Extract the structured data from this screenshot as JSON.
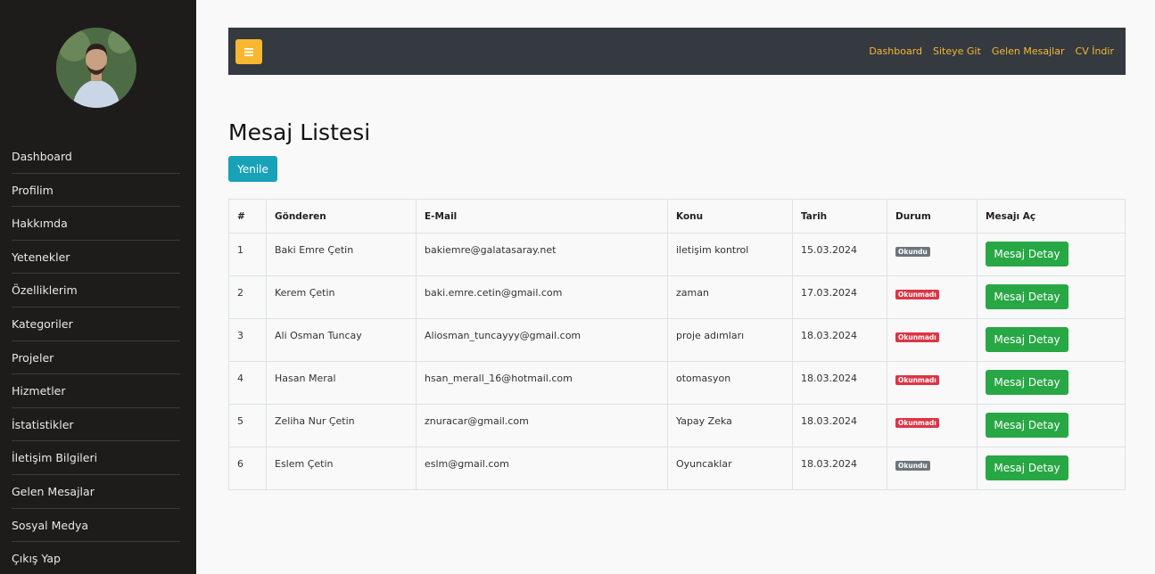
{
  "sidebar": {
    "items": [
      {
        "label": "Dashboard"
      },
      {
        "label": "Profilim"
      },
      {
        "label": "Hakkımda"
      },
      {
        "label": "Yetenekler"
      },
      {
        "label": "Özelliklerim"
      },
      {
        "label": "Kategoriler"
      },
      {
        "label": "Projeler"
      },
      {
        "label": "Hizmetler"
      },
      {
        "label": "İstatistikler"
      },
      {
        "label": "İletişim Bilgileri"
      },
      {
        "label": "Gelen Mesajlar"
      },
      {
        "label": "Sosyal Medya"
      },
      {
        "label": "Çıkış Yap"
      }
    ]
  },
  "topbar": {
    "toggle_icon": "menu-icon",
    "links": [
      {
        "label": "Dashboard"
      },
      {
        "label": "Siteye Git"
      },
      {
        "label": "Gelen Mesajlar"
      },
      {
        "label": "CV İndir"
      }
    ],
    "accent_color": "#f7b731",
    "background_color": "#343a40"
  },
  "main": {
    "title": "Mesaj Listesi",
    "refresh_label": "Yenile",
    "table": {
      "headers": [
        "#",
        "Gönderen",
        "E-Mail",
        "Konu",
        "Tarih",
        "Durum",
        "Mesajı Aç"
      ],
      "rows": [
        {
          "no": "1",
          "sender": "Baki Emre Çetin",
          "email": "bakiemre@galatasaray.net",
          "subject": "iletişim kontrol",
          "date": "15.03.2024",
          "status": "Okundu",
          "status_color": "#6c757d",
          "action": "Mesaj Detay"
        },
        {
          "no": "2",
          "sender": "Kerem Çetin",
          "email": "baki.emre.cetin@gmail.com",
          "subject": "zaman",
          "date": "17.03.2024",
          "status": "Okunmadı",
          "status_color": "#dc3545",
          "action": "Mesaj Detay"
        },
        {
          "no": "3",
          "sender": "Ali Osman Tuncay",
          "email": "Aliosman_tuncayyy@gmail.com",
          "subject": "proje adımları",
          "date": "18.03.2024",
          "status": "Okunmadı",
          "status_color": "#dc3545",
          "action": "Mesaj Detay"
        },
        {
          "no": "4",
          "sender": "Hasan Meral",
          "email": "hsan_merall_16@hotmail.com",
          "subject": "otomasyon",
          "date": "18.03.2024",
          "status": "Okunmadı",
          "status_color": "#dc3545",
          "action": "Mesaj Detay"
        },
        {
          "no": "5",
          "sender": "Zeliha Nur Çetin",
          "email": "znuracar@gmail.com",
          "subject": "Yapay Zeka",
          "date": "18.03.2024",
          "status": "Okunmadı",
          "status_color": "#dc3545",
          "action": "Mesaj Detay"
        },
        {
          "no": "6",
          "sender": "Eslem Çetin",
          "email": "eslm@gmail.com",
          "subject": "Oyuncaklar",
          "date": "18.03.2024",
          "status": "Okundu",
          "status_color": "#6c757d",
          "action": "Mesaj Detay"
        }
      ]
    }
  },
  "colors": {
    "sidebar_bg": "#1e1b1b",
    "refresh_button": "#17a2b8",
    "detail_button": "#28a745"
  }
}
